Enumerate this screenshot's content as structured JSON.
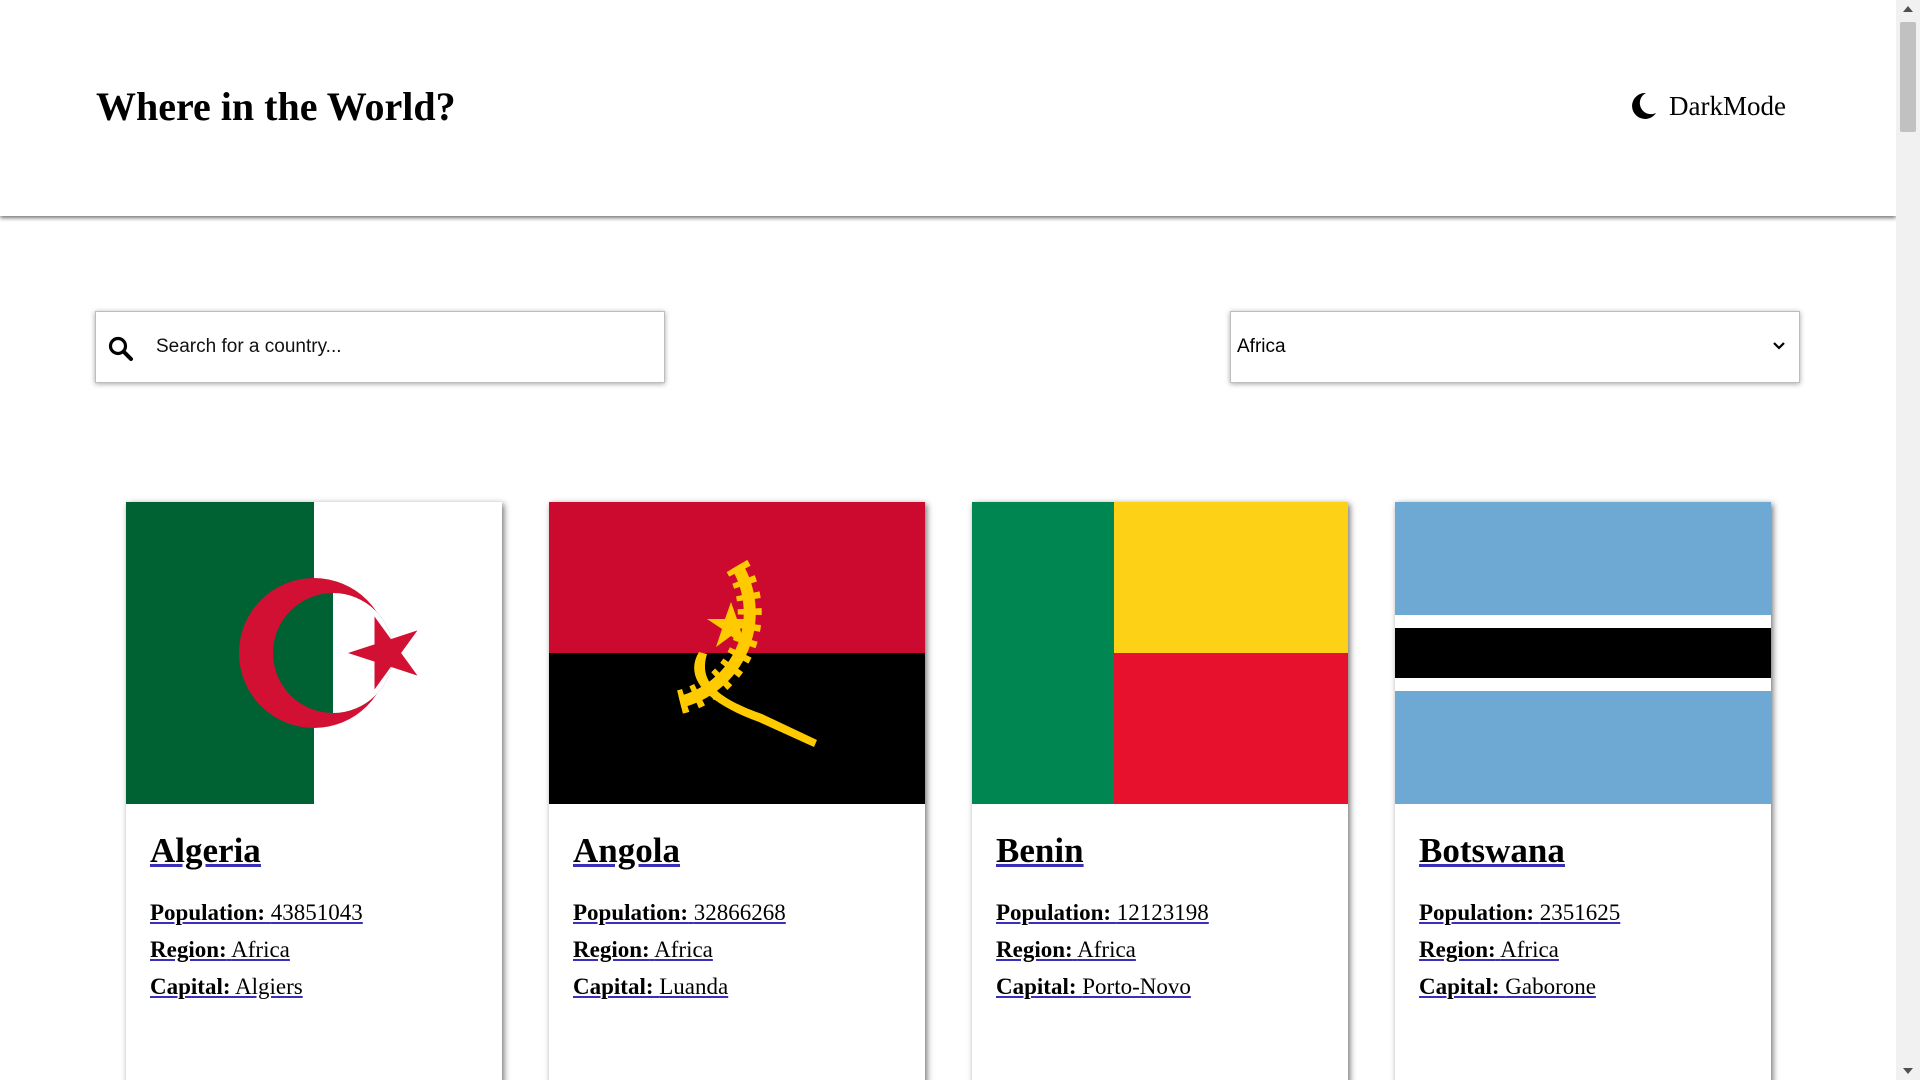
{
  "header": {
    "title": "Where in the World?",
    "darkmode_label": "DarkMode",
    "darkmode_icon": "moon-icon"
  },
  "search": {
    "placeholder": "Search for a country...",
    "value": "",
    "icon": "search-icon"
  },
  "filter": {
    "selected": "Africa",
    "icon": "chevron-down-icon"
  },
  "labels": {
    "population": "Population:",
    "region": "Region:",
    "capital": "Capital:"
  },
  "countries": [
    {
      "name": "Algeria",
      "population": "43851043",
      "region": "Africa",
      "capital": "Algiers",
      "flag": {
        "colors": [
          "#006233",
          "#ffffff",
          "#d21034"
        ]
      }
    },
    {
      "name": "Angola",
      "population": "32866268",
      "region": "Africa",
      "capital": "Luanda",
      "flag": {
        "colors": [
          "#cc092f",
          "#000000",
          "#ffcb00"
        ]
      }
    },
    {
      "name": "Benin",
      "population": "12123198",
      "region": "Africa",
      "capital": "Porto-Novo",
      "flag": {
        "colors": [
          "#008751",
          "#fcd116",
          "#e8112d"
        ]
      }
    },
    {
      "name": "Botswana",
      "population": "2351625",
      "region": "Africa",
      "capital": "Gaborone",
      "flag": {
        "colors": [
          "#6da9d2",
          "#ffffff",
          "#000000"
        ]
      }
    }
  ],
  "colors": {
    "link_underline": "#3a2fb8",
    "background": "#ffffff"
  }
}
